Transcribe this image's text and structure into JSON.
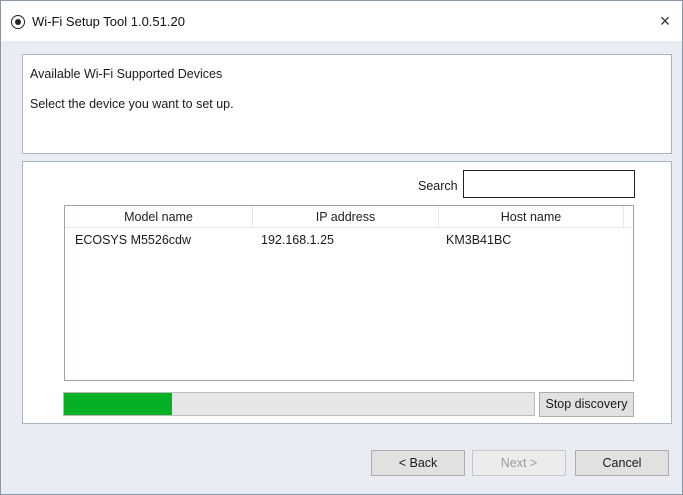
{
  "window": {
    "title": "Wi-Fi Setup Tool 1.0.51.20",
    "close_label": "×"
  },
  "header": {
    "title": "Available Wi-Fi Supported Devices",
    "subtitle": "Select the device you want to set up."
  },
  "search": {
    "label": "Search",
    "value": ""
  },
  "table": {
    "columns": [
      "Model name",
      "IP address",
      "Host name"
    ],
    "rows": [
      {
        "model": "ECOSYS M5526cdw",
        "ip": "192.168.1.25",
        "host": "KM3B41BC"
      }
    ]
  },
  "discovery": {
    "progress_fraction": 0.23,
    "progress_color": "#06b025",
    "stop_label": "Stop discovery"
  },
  "footer": {
    "back_label": "< Back",
    "next_label": "Next >",
    "cancel_label": "Cancel"
  }
}
